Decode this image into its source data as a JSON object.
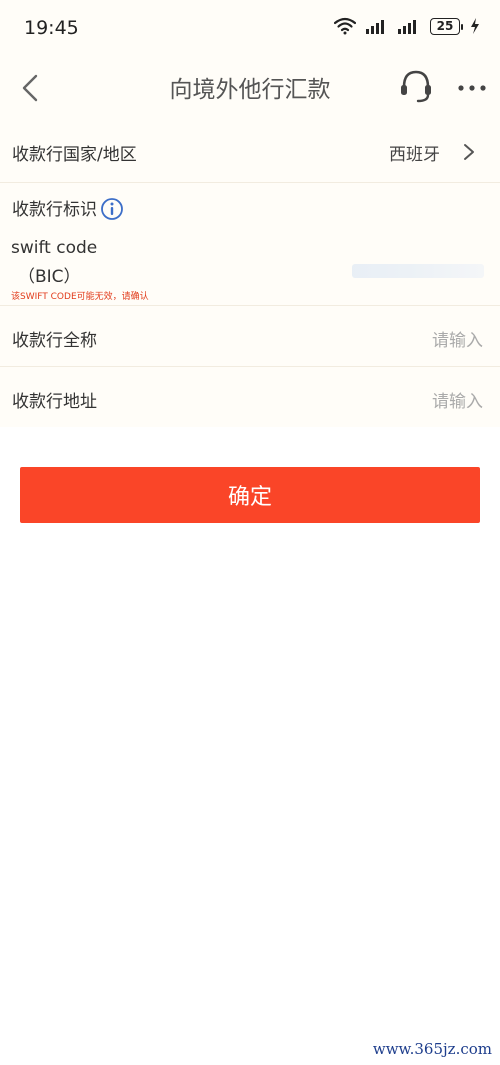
{
  "status_bar": {
    "time": "19:45",
    "battery": "25",
    "icons": [
      "wifi-icon",
      "signal-icon",
      "signal-icon",
      "battery-icon",
      "charging-icon"
    ]
  },
  "nav": {
    "title": "向境外他行汇款",
    "icons": [
      "back-icon",
      "customer-service-icon",
      "more-icon"
    ]
  },
  "form": {
    "country": {
      "label": "收款行国家/地区",
      "value": "西班牙"
    },
    "bank_id": {
      "label": "收款行标识"
    },
    "swift": {
      "label_line1": "swift code",
      "label_line2": "（BIC）",
      "error": "该SWIFT CODE可能无效，请确认"
    },
    "bank_name": {
      "label": "收款行全称",
      "placeholder": "请输入"
    },
    "bank_address": {
      "label": "收款行地址",
      "placeholder": "请输入"
    }
  },
  "confirm_label": "确定",
  "watermark": "www.365jz.com",
  "colors": {
    "accent": "#fa4528",
    "error": "#e23c1c",
    "form_bg": "#fffdf8",
    "info_icon": "#3c6ec8"
  }
}
